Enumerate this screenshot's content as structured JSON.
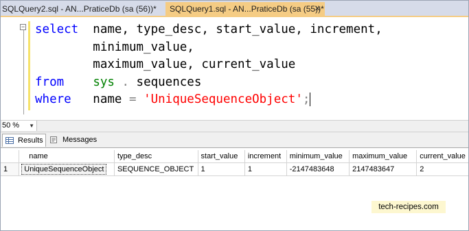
{
  "tabs": [
    {
      "label": "SQLQuery2.sql - AN...PraticeDb (sa (56))*",
      "active": false
    },
    {
      "label": "SQLQuery1.sql - AN...PraticeDb (sa (55))*",
      "active": true,
      "close": "✕"
    }
  ],
  "editor": {
    "line1": {
      "kw": "select",
      "rest": "  name, type_desc, start_value, increment,"
    },
    "line2": {
      "rest": "minimum_value,"
    },
    "line3": {
      "rest": "maximum_value, current_value"
    },
    "line4": {
      "kw": "from",
      "sys": "sys",
      "dot": " . ",
      "rest": "sequences"
    },
    "line5": {
      "kw": "where",
      "name": "name",
      "eq": " = ",
      "str": "'UniqueSequenceObject'",
      "semi": ";"
    },
    "outline_symbol": "−"
  },
  "zoom": {
    "value": "50 %"
  },
  "results_tabs": {
    "results": "Results",
    "messages": "Messages"
  },
  "grid": {
    "columns": [
      "name",
      "type_desc",
      "start_value",
      "increment",
      "minimum_value",
      "maximum_value",
      "current_value"
    ],
    "rows": [
      {
        "num": "1",
        "cells": [
          "UniqueSequenceObject",
          "SEQUENCE_OBJECT",
          "1",
          "1",
          "-2147483648",
          "2147483647",
          "2"
        ]
      }
    ]
  },
  "watermark": "tech-recipes.com",
  "colors": {
    "active_tab": "#f5cc84",
    "keyword": "#0000ff",
    "string": "#ff0000",
    "system": "#008000"
  }
}
